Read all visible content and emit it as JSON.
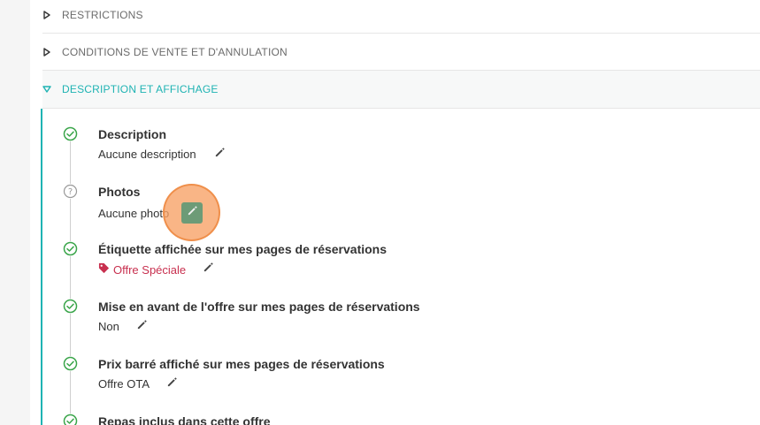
{
  "sections": {
    "restrictions": "RESTRICTIONS",
    "conditions": "CONDITIONS DE VENTE ET D'ANNULATION",
    "description_affichage": "DESCRIPTION ET AFFICHAGE"
  },
  "items": [
    {
      "title": "Description",
      "value": "Aucune description",
      "status": "check"
    },
    {
      "title": "Photos",
      "value": "Aucune photo",
      "status": "question"
    },
    {
      "title": "Étiquette affichée sur mes pages de réservations",
      "value": "Offre Spéciale",
      "status": "check"
    },
    {
      "title": "Mise en avant de l'offre sur mes pages de réservations",
      "value": "Non",
      "status": "check"
    },
    {
      "title": "Prix barré affiché sur mes pages de réservations",
      "value": "Offre OTA",
      "status": "check"
    },
    {
      "title": "Repas inclus dans cette offre",
      "status": "check"
    }
  ],
  "colors": {
    "accent": "#1fb3b3",
    "check": "#3aa54a",
    "tag": "#c8304f"
  },
  "icons": {
    "collapsed": "caret-right-icon",
    "expanded": "caret-down-icon",
    "edit": "pencil-icon",
    "tag": "tag-icon"
  }
}
